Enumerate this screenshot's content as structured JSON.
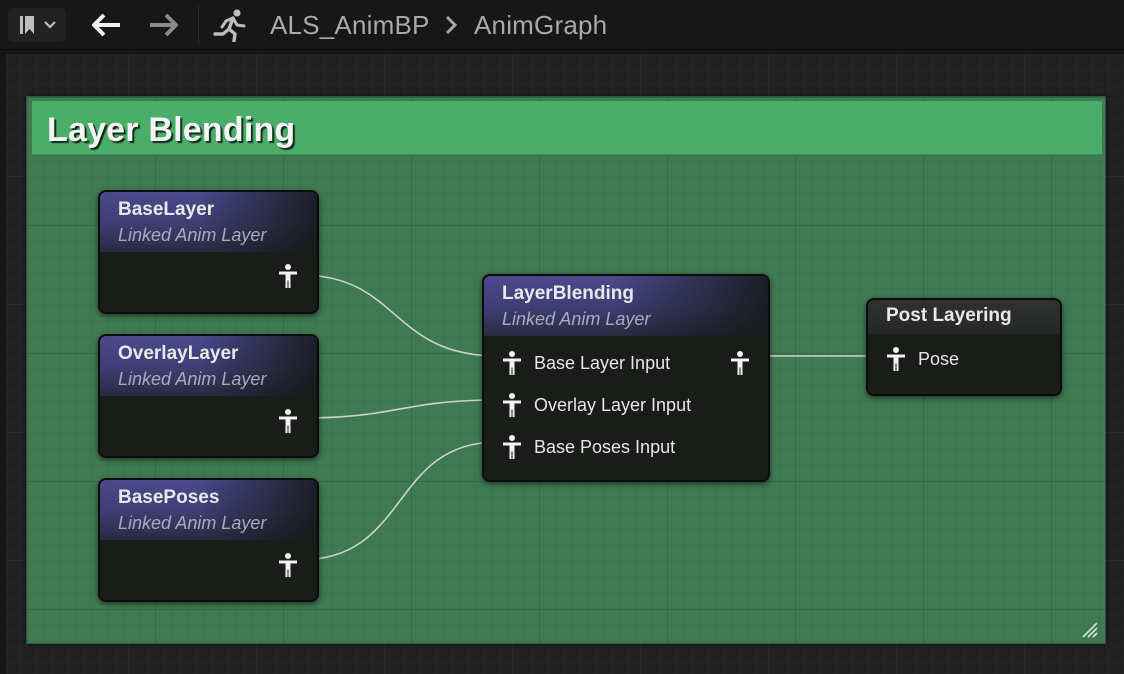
{
  "toolbar": {
    "breadcrumb_asset": "ALS_AnimBP",
    "breadcrumb_graph": "AnimGraph",
    "icons": [
      "bookmark-icon",
      "chevron-down-icon",
      "back-arrow-icon",
      "forward-arrow-icon",
      "running-man-icon",
      "chevron-right-icon"
    ]
  },
  "comment": {
    "title": "Layer Blending",
    "color": "#4aae6a"
  },
  "nodes": {
    "base_layer": {
      "title": "BaseLayer",
      "subtitle": "Linked Anim Layer"
    },
    "overlay_layer": {
      "title": "OverlayLayer",
      "subtitle": "Linked Anim Layer"
    },
    "base_poses": {
      "title": "BasePoses",
      "subtitle": "Linked Anim Layer"
    },
    "layer_blending": {
      "title": "LayerBlending",
      "subtitle": "Linked Anim Layer",
      "inputs": [
        "Base Layer Input",
        "Overlay Layer Input",
        "Base Poses Input"
      ]
    },
    "post_layering": {
      "title": "Post Layering",
      "input": "Pose"
    }
  },
  "colors": {
    "anim_layer_header": "#4b4a8d",
    "wire": "#cfd2cf"
  }
}
